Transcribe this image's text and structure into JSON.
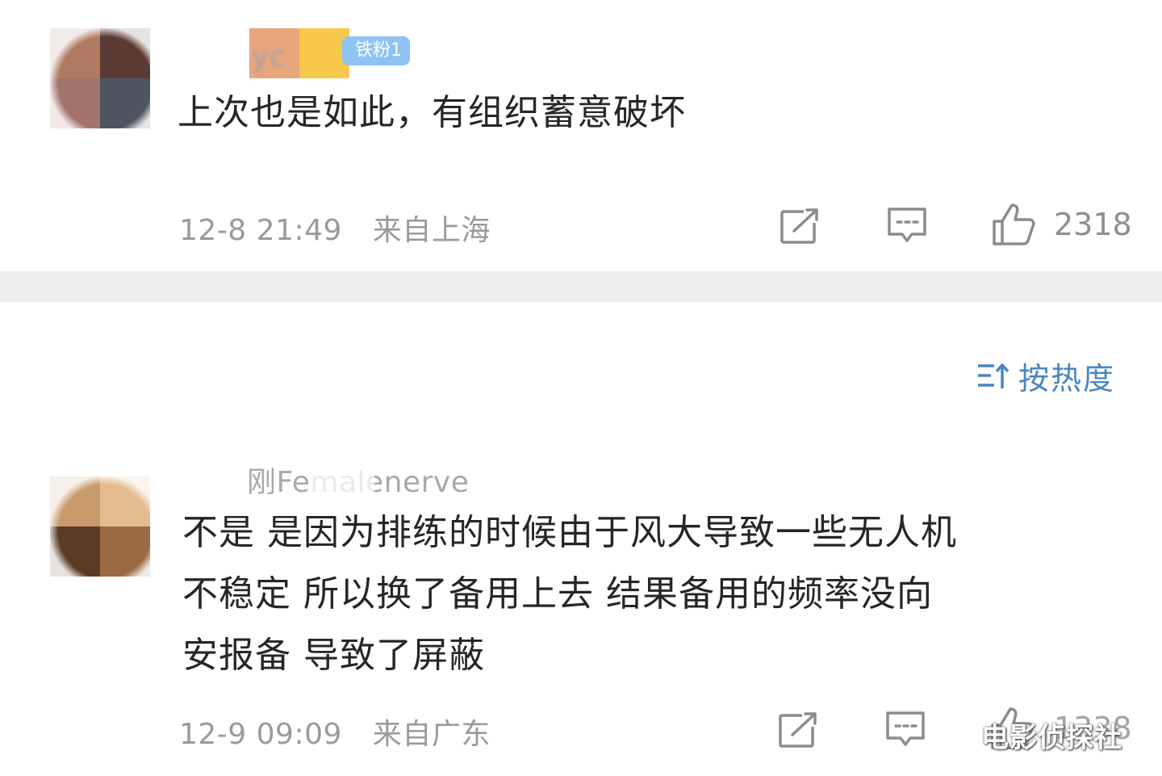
{
  "comments": [
    {
      "username": "yc",
      "fan_badge": "铁粉1",
      "text_lines": [
        "上次也是如此，有组织蓄意破坏"
      ],
      "date": "12-8 21:49",
      "location": "来自上海",
      "like_count": "2318"
    },
    {
      "username": "刚Femalenerve",
      "text_lines": [
        "不是  是因为排练的时候由于风大导致一些无人机",
        "不稳定  所以换了备用上去  结果备用的频率没向",
        "安报备 导致了屏蔽"
      ],
      "date": "12-9 09:09",
      "location": "来自广东",
      "like_count": "1338"
    }
  ],
  "sort": {
    "label": "按热度"
  },
  "watermark": "电影侦探社",
  "icons": {
    "share": "share-icon",
    "comment": "comment-icon",
    "like": "thumbs-up-icon",
    "sort": "sort-icon"
  },
  "colors": {
    "sort_accent": "#4a86c0",
    "badge": "#8fc3f5",
    "divider": "#ededed",
    "meta_text": "#9a9a9a"
  }
}
